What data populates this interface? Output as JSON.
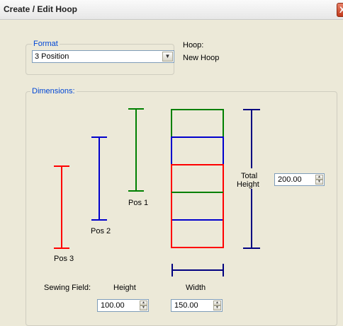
{
  "window": {
    "title": "Create / Edit Hoop",
    "close_label": "X"
  },
  "format_group": {
    "legend": "Format",
    "selected": "3 Position",
    "dropdown_icon": "chevron-down-icon"
  },
  "hoop_info": {
    "label": "Hoop:",
    "name": "New Hoop"
  },
  "dimensions_group": {
    "legend": "Dimensions:",
    "positions": [
      {
        "label": "Pos 1",
        "color": "#008000"
      },
      {
        "label": "Pos 2",
        "color": "#0000cc"
      },
      {
        "label": "Pos 3",
        "color": "#ff0000"
      }
    ],
    "total_height_label_1": "Total",
    "total_height_label_2": "Height",
    "total_height_value": "200.00",
    "sewing_field_label": "Sewing Field:",
    "height_label": "Height",
    "height_value": "100.00",
    "width_label": "Width",
    "width_value": "150.00",
    "dimension_line_color": "#000080"
  },
  "spinner_icons": {
    "up": "▲",
    "down": "▼"
  }
}
